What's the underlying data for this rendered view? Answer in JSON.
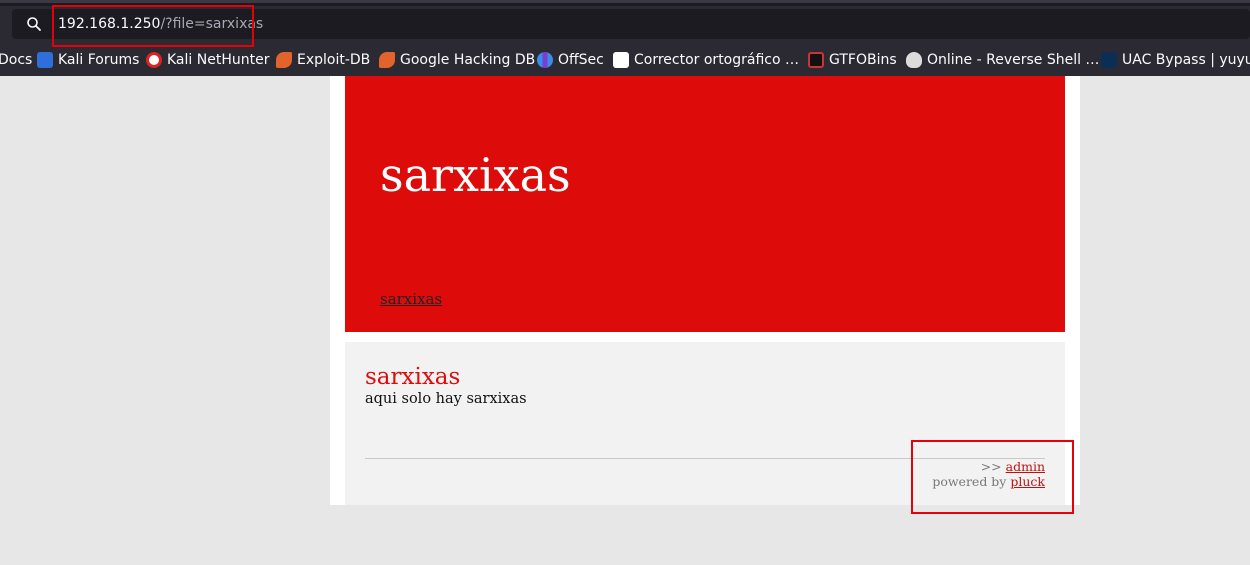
{
  "browser": {
    "url_host": "192.168.1.250",
    "url_path": "/?file=sarxixas",
    "bookmarks": [
      {
        "label": "Docs",
        "icon": "docs-icon"
      },
      {
        "label": "Kali Forums",
        "icon": "kali-forums-icon"
      },
      {
        "label": "Kali NetHunter",
        "icon": "kali-nethunter-icon"
      },
      {
        "label": "Exploit-DB",
        "icon": "exploit-db-icon"
      },
      {
        "label": "Google Hacking DB",
        "icon": "google-hacking-db-icon"
      },
      {
        "label": "OffSec",
        "icon": "offsec-icon"
      },
      {
        "label": "Corrector ortográfico …",
        "icon": "corrector-icon"
      },
      {
        "label": "GTFOBins",
        "icon": "gtfobins-icon"
      },
      {
        "label": "Online - Reverse Shell …",
        "icon": "skull-icon"
      },
      {
        "label": "UAC Bypass | yuyudh",
        "icon": "uac-bypass-icon"
      }
    ]
  },
  "site": {
    "title": "sarxixas",
    "nav_link": "sarxixas",
    "page_title": "sarxixas",
    "page_text": "aqui solo hay sarxixas",
    "footer": {
      "prefix": ">>",
      "admin_link": "admin",
      "powered_by": "powered by",
      "pluck_link": "pluck"
    }
  },
  "colors": {
    "header_bg": "#de0b0b",
    "annotation": "#e5000a",
    "toolbar_bg": "#2b2a33"
  }
}
